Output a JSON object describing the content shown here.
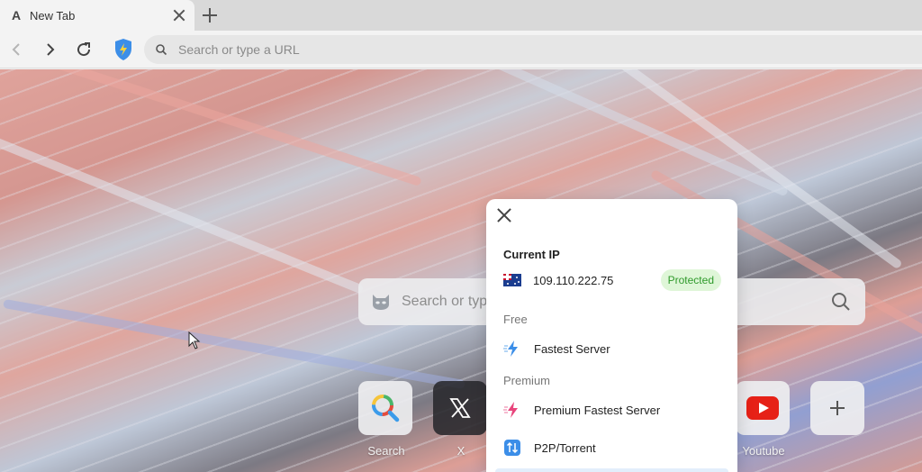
{
  "tab": {
    "title": "New Tab"
  },
  "toolbar": {
    "url_placeholder": "Search or type a URL"
  },
  "main_search": {
    "placeholder": "Search or type"
  },
  "shortcuts": [
    {
      "label": "Search",
      "icon": "search-magnifier-icon"
    },
    {
      "label": "X",
      "icon": "x-logo-icon"
    },
    {
      "label": "Youtube",
      "icon": "youtube-icon"
    },
    {
      "label": "",
      "icon": "plus-icon"
    }
  ],
  "vpn": {
    "current_ip_heading": "Current IP",
    "ip": "109.110.222.75",
    "status": "Protected",
    "free_heading": "Free",
    "free_server": "Fastest Server",
    "premium_heading": "Premium",
    "premium_server": "Premium Fastest Server",
    "p2p_server": "P2P/Torrent"
  },
  "colors": {
    "accent_blue": "#3c8ee8",
    "badge_bg": "#dff6d8",
    "badge_text": "#2f9a2b",
    "premium_pink": "#e8457c"
  }
}
